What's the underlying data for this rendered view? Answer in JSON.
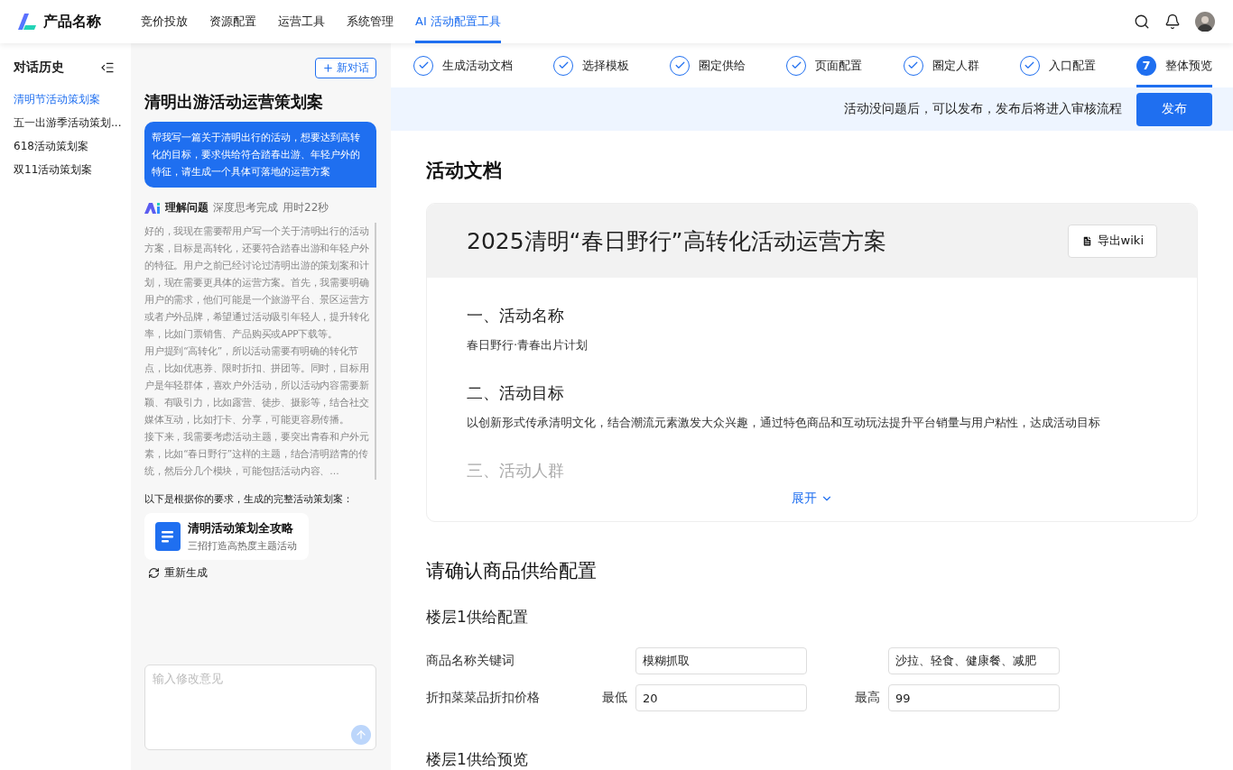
{
  "nav": {
    "product_name": "产品名称",
    "items": [
      {
        "label": "竞价投放",
        "selected": false
      },
      {
        "label": "资源配置",
        "selected": false
      },
      {
        "label": "运营工具",
        "selected": false
      },
      {
        "label": "系统管理",
        "selected": false
      },
      {
        "label": "AI 活动配置工具",
        "selected": true
      }
    ]
  },
  "history": {
    "title": "对话历史",
    "items": [
      {
        "label": "清明节活动策划案",
        "selected": true
      },
      {
        "label": "五一出游季活动策划...",
        "selected": false
      },
      {
        "label": "618活动策划案",
        "selected": false
      },
      {
        "label": "双11活动策划案",
        "selected": false
      }
    ]
  },
  "chat": {
    "new_button": "新对话",
    "title": "清明出游活动运营策划案",
    "user_message": "帮我写一篇关于清明出行的活动，想要达到高转化的目标，要求供给符合踏春出游、年轻户外的特征，请生成一个具体可落地的运营方案",
    "thinking": {
      "label": "理解问题",
      "status": "深度思考完成",
      "duration": "用时22秒",
      "paragraphs": [
        "好的，我现在需要帮用户写一个关于清明出行的活动方案，目标是高转化，还要符合踏春出游和年轻户外的特征。用户之前已经讨论过清明出游的策划案和计划，现在需要更具体的运营方案。首先，我需要明确用户的需求，他们可能是一个旅游平台、景区运营方或者户外品牌，希望通过活动吸引年轻人，提升转化率，比如门票销售、产品购买或APP下载等。",
        "用户提到“高转化”，所以活动需要有明确的转化节点，比如优惠券、限时折扣、拼团等。同时，目标用户是年轻群体，喜欢户外活动，所以活动内容需要新颖、有吸引力，比如露营、徒步、摄影等，结合社交媒体互动，比如打卡、分享，可能更容易传播。",
        "接下来，我需要考虑活动主题，要突出青春和户外元素，比如“春日野行”这样的主题，结合清明踏青的传统，然后分几个模块，可能包括活动内容、…"
      ]
    },
    "result_intro": "以下是根据你的要求，生成的完整活动策划案：",
    "doc_card": {
      "title": "清明活动策划全攻略",
      "subtitle": "三招打造高热度主题活动"
    },
    "regenerate": "重新生成",
    "input_placeholder": "输入修改意见"
  },
  "steps": [
    {
      "label": "生成活动文档",
      "kind": "done",
      "selected": false
    },
    {
      "label": "选择模板",
      "kind": "done",
      "selected": false
    },
    {
      "label": "圈定供给",
      "kind": "done",
      "selected": false
    },
    {
      "label": "页面配置",
      "kind": "done",
      "selected": false
    },
    {
      "label": "圈定人群",
      "kind": "done",
      "selected": false
    },
    {
      "label": "入口配置",
      "kind": "done",
      "selected": false
    },
    {
      "label": "整体预览",
      "kind": "current",
      "number": "7",
      "selected": true
    }
  ],
  "notice": {
    "text": "活动没问题后，可以发布，发布后将进入审核流程",
    "button": "发布"
  },
  "document": {
    "heading": "活动文档",
    "title": "2025清明“春日野行”高转化活动运营方案",
    "export_button": "导出wiki",
    "sections": [
      {
        "heading": "一、活动名称",
        "body": "春日野行·青春出片计划"
      },
      {
        "heading": "二、活动目标",
        "body": "以创新形式传承清明文化，结合潮流元素激发大众兴趣，通过特色商品和互动玩法提升平台销量与用户粘性，达成活动目标"
      }
    ],
    "collapsed_heading": "三、活动人群",
    "expand": "展开"
  },
  "supply": {
    "heading": "请确认商品供给配置",
    "floor_title": "楼层1供给配置",
    "rows": [
      {
        "label": "商品名称关键词",
        "fields": [
          {
            "value": "模糊抓取"
          },
          {
            "value": "沙拉、轻食、健康餐、减肥"
          }
        ]
      },
      {
        "label": "折扣菜菜品折扣价格",
        "fields": [
          {
            "prefix": "最低",
            "value": "20"
          },
          {
            "prefix": "最高",
            "value": "99"
          }
        ]
      }
    ],
    "preview_title": "楼层1供给预览"
  }
}
